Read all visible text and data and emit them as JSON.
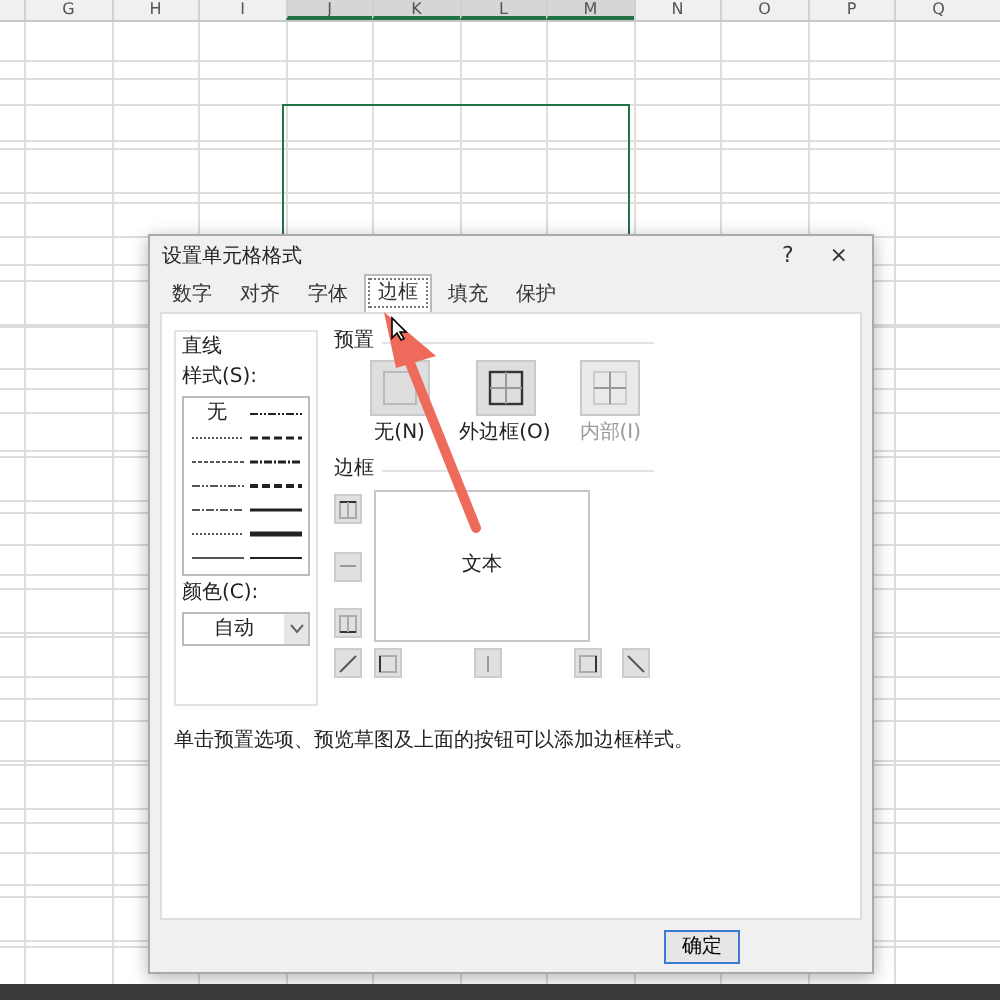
{
  "spreadsheet": {
    "columns": [
      {
        "label": "G",
        "selected": false
      },
      {
        "label": "H",
        "selected": false
      },
      {
        "label": "I",
        "selected": false
      },
      {
        "label": "J",
        "selected": true
      },
      {
        "label": "K",
        "selected": true
      },
      {
        "label": "L",
        "selected": true
      },
      {
        "label": "M",
        "selected": true
      },
      {
        "label": "N",
        "selected": false
      },
      {
        "label": "O",
        "selected": false
      },
      {
        "label": "P",
        "selected": false
      },
      {
        "label": "Q",
        "selected": false
      }
    ]
  },
  "dialog": {
    "title": "设置单元格格式",
    "help": "?",
    "close": "×",
    "tabs": [
      {
        "label": "数字",
        "selected": false
      },
      {
        "label": "对齐",
        "selected": false
      },
      {
        "label": "字体",
        "selected": false
      },
      {
        "label": "边框",
        "selected": true
      },
      {
        "label": "填充",
        "selected": false
      },
      {
        "label": "保护",
        "selected": false
      }
    ],
    "line": {
      "heading": "直线",
      "style_label": "样式(S):",
      "none_label": "无",
      "color_label": "颜色(C):",
      "color_value": "自动"
    },
    "presets": {
      "heading": "预置",
      "buttons": [
        {
          "label": "无(N)",
          "kind": "none",
          "disabled": false
        },
        {
          "label": "外边框(O)",
          "kind": "outline",
          "disabled": false
        },
        {
          "label": "内部(I)",
          "kind": "inside",
          "disabled": true
        }
      ]
    },
    "border": {
      "heading": "边框",
      "preview_text": "文本"
    },
    "hint": "单击预置选项、预览草图及上面的按钮可以添加边框样式。",
    "buttons": [
      "确定"
    ]
  }
}
